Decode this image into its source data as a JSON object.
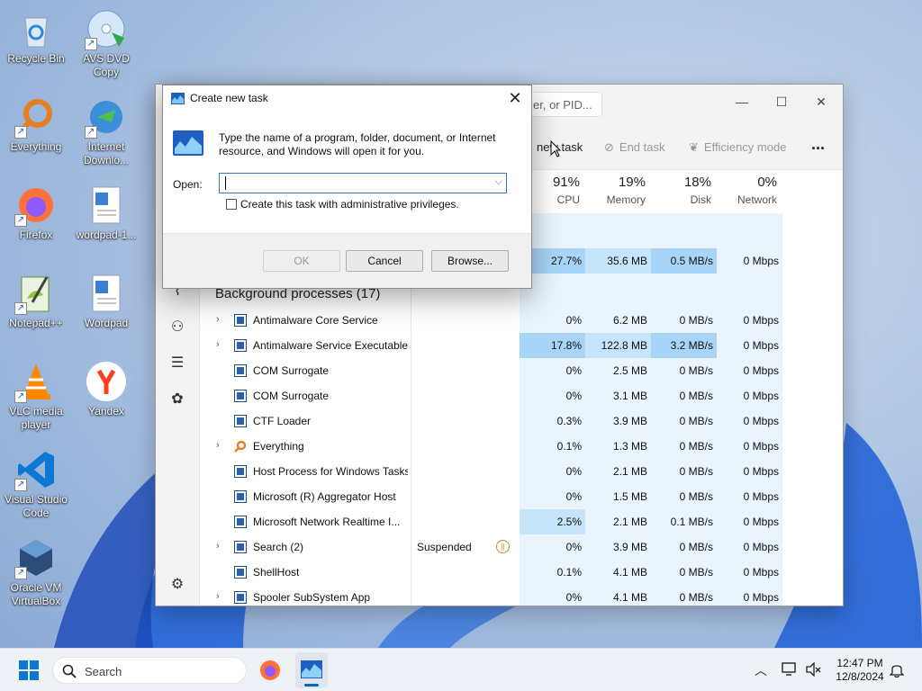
{
  "desktop": {
    "icons": [
      {
        "label": "Recycle Bin",
        "icon": "recycle-bin-icon"
      },
      {
        "label": "AVS DVD Copy",
        "icon": "dvd-icon"
      },
      {
        "label": "Everything",
        "icon": "everything-search-icon"
      },
      {
        "label": "Internet Downlo...",
        "icon": "download-manager-icon"
      },
      {
        "label": "Firefox",
        "icon": "firefox-icon"
      },
      {
        "label": "wordpad-1...",
        "icon": "wordpad-doc-icon"
      },
      {
        "label": "Notepad++",
        "icon": "notepadpp-icon"
      },
      {
        "label": "Wordpad",
        "icon": "wordpad-icon"
      },
      {
        "label": "VLC media player",
        "icon": "vlc-icon"
      },
      {
        "label": "Yandex",
        "icon": "yandex-icon"
      },
      {
        "label": "Visual Studio Code",
        "icon": "vscode-icon"
      },
      {
        "label": "Oracle VM VirtualBox",
        "icon": "virtualbox-icon"
      }
    ]
  },
  "task_manager": {
    "search_placeholder": "er, or PID...",
    "toolbar": {
      "run_new_task": "new task",
      "end_task": "End task",
      "efficiency_mode": "Efficiency mode",
      "more": "..."
    },
    "columns": {
      "cpu": {
        "pct": "91%",
        "label": "CPU"
      },
      "memory": {
        "pct": "19%",
        "label": "Memory"
      },
      "disk": {
        "pct": "18%",
        "label": "Disk"
      },
      "network": {
        "pct": "0%",
        "label": "Network"
      }
    },
    "top_row": {
      "cpu": "27.7%",
      "memory": "35.6 MB",
      "disk": "0.5 MB/s",
      "network": "0 Mbps"
    },
    "section_title": "Background processes (17)",
    "processes": [
      {
        "name": "Antimalware Core Service",
        "expand": true,
        "status": "",
        "cpu": "0%",
        "memory": "6.2 MB",
        "disk": "0 MB/s",
        "network": "0 Mbps"
      },
      {
        "name": "Antimalware Service Executable",
        "expand": true,
        "status": "",
        "cpu": "17.8%",
        "memory": "122.8 MB",
        "disk": "3.2 MB/s",
        "network": "0 Mbps"
      },
      {
        "name": "COM Surrogate",
        "expand": false,
        "status": "",
        "cpu": "0%",
        "memory": "2.5 MB",
        "disk": "0 MB/s",
        "network": "0 Mbps"
      },
      {
        "name": "COM Surrogate",
        "expand": false,
        "status": "",
        "cpu": "0%",
        "memory": "3.1 MB",
        "disk": "0 MB/s",
        "network": "0 Mbps"
      },
      {
        "name": "CTF Loader",
        "expand": false,
        "status": "",
        "cpu": "0.3%",
        "memory": "3.9 MB",
        "disk": "0 MB/s",
        "network": "0 Mbps"
      },
      {
        "name": "Everything",
        "expand": true,
        "status": "",
        "cpu": "0.1%",
        "memory": "1.3 MB",
        "disk": "0 MB/s",
        "network": "0 Mbps"
      },
      {
        "name": "Host Process for Windows Tasks",
        "expand": false,
        "status": "",
        "cpu": "0%",
        "memory": "2.1 MB",
        "disk": "0 MB/s",
        "network": "0 Mbps"
      },
      {
        "name": "Microsoft (R) Aggregator Host",
        "expand": false,
        "status": "",
        "cpu": "0%",
        "memory": "1.5 MB",
        "disk": "0 MB/s",
        "network": "0 Mbps"
      },
      {
        "name": "Microsoft Network Realtime I...",
        "expand": false,
        "status": "",
        "cpu": "2.5%",
        "memory": "2.1 MB",
        "disk": "0.1 MB/s",
        "network": "0 Mbps"
      },
      {
        "name": "Search (2)",
        "expand": true,
        "status": "Suspended",
        "cpu": "0%",
        "memory": "3.9 MB",
        "disk": "0 MB/s",
        "network": "0 Mbps"
      },
      {
        "name": "ShellHost",
        "expand": false,
        "status": "",
        "cpu": "0.1%",
        "memory": "4.1 MB",
        "disk": "0 MB/s",
        "network": "0 Mbps"
      },
      {
        "name": "Spooler SubSystem App",
        "expand": true,
        "status": "",
        "cpu": "0%",
        "memory": "4.1 MB",
        "disk": "0 MB/s",
        "network": "0 Mbps"
      }
    ]
  },
  "dialog": {
    "title": "Create new task",
    "description": "Type the name of a program, folder, document, or Internet resource, and Windows will open it for you.",
    "open_label": "Open:",
    "open_value": "",
    "admin_checkbox_label": "Create this task with administrative privileges.",
    "ok": "OK",
    "cancel": "Cancel",
    "browse": "Browse..."
  },
  "taskbar": {
    "search_placeholder": "Search",
    "time": "12:47 PM",
    "date": "12/8/2024"
  },
  "colors": {
    "heat_light": "#e9f4fd",
    "heat_mid": "#c6e4fa",
    "heat_strong": "#a8d5f7",
    "accent": "#0067c0"
  }
}
